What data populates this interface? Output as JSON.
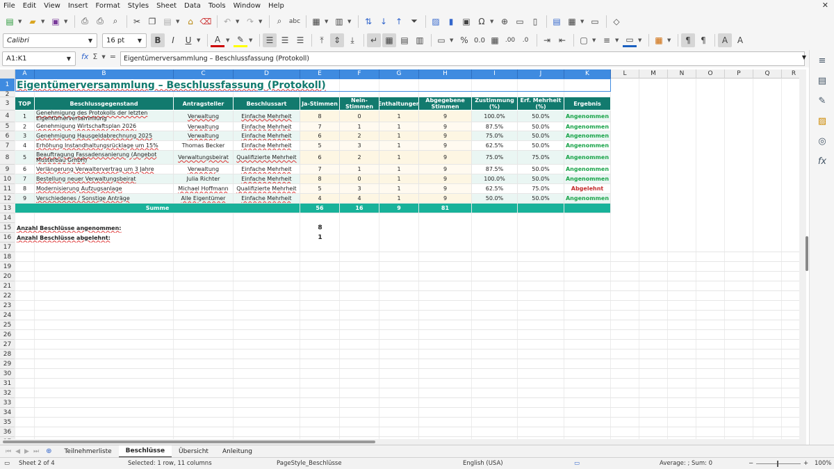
{
  "menu": [
    "File",
    "Edit",
    "View",
    "Insert",
    "Format",
    "Styles",
    "Sheet",
    "Data",
    "Tools",
    "Window",
    "Help"
  ],
  "toolbar": {
    "font_name": "Calibri",
    "font_size": "16 pt"
  },
  "formula_bar": {
    "name_box": "A1:K1",
    "sum_symbol": "Σ",
    "equals_symbol": "=",
    "content": "Eigentümerversammlung – Beschlussfassung (Protokoll)"
  },
  "columns": [
    "A",
    "B",
    "C",
    "D",
    "E",
    "F",
    "G",
    "H",
    "I",
    "J",
    "K",
    "L",
    "M",
    "N",
    "O",
    "P",
    "Q",
    "R"
  ],
  "rows": [
    "1",
    "2",
    "3",
    "4",
    "5",
    "6",
    "7",
    "8",
    "9",
    "10",
    "11",
    "12",
    "13",
    "14",
    "15",
    "16",
    "17",
    "18",
    "19",
    "20",
    "21",
    "22",
    "23",
    "24",
    "25",
    "26",
    "27",
    "28",
    "29",
    "30",
    "31",
    "32",
    "33",
    "34",
    "35",
    "36",
    "37"
  ],
  "sheet": {
    "title": "Eigentümerversammlung – Beschlussfassung (Protokoll)",
    "headers": [
      "TOP",
      "Beschlussgegenstand",
      "Antragsteller",
      "Beschlussart",
      "Ja-Stimmen",
      "Nein-Stimmen",
      "Enthaltungen",
      "Abgegebene Stimmen",
      "Zustimmung (%)",
      "Erf. Mehrheit (%)",
      "Ergebnis"
    ],
    "data_rows": [
      [
        "1",
        "Genehmigung des Protokolls der letzten Eigentümerversammlung",
        "Verwaltung",
        "Einfache Mehrheit",
        "8",
        "0",
        "1",
        "9",
        "100.0%",
        "50.0%",
        "Angenommen"
      ],
      [
        "2",
        "Genehmigung Wirtschaftsplan 2026",
        "Verwaltung",
        "Einfache Mehrheit",
        "7",
        "1",
        "1",
        "9",
        "87.5%",
        "50.0%",
        "Angenommen"
      ],
      [
        "3",
        "Genehmigung Hausgeldabrechnung 2025",
        "Verwaltung",
        "Einfache Mehrheit",
        "6",
        "2",
        "1",
        "9",
        "75.0%",
        "50.0%",
        "Angenommen"
      ],
      [
        "4",
        "Erhöhung Instandhaltungsrücklage um 15%",
        "Thomas Becker",
        "Einfache Mehrheit",
        "5",
        "3",
        "1",
        "9",
        "62.5%",
        "50.0%",
        "Angenommen"
      ],
      [
        "5",
        "Beauftragung Fassadensanierung (Angebot Musterbau GmbH)",
        "Verwaltungsbeirat",
        "Qualifizierte Mehrheit",
        "6",
        "2",
        "1",
        "9",
        "75.0%",
        "75.0%",
        "Angenommen"
      ],
      [
        "6",
        "Verlängerung Verwaltervertrag um 3 Jahre",
        "Verwaltung",
        "Einfache Mehrheit",
        "7",
        "1",
        "1",
        "9",
        "87.5%",
        "50.0%",
        "Angenommen"
      ],
      [
        "7",
        "Bestellung neuer Verwaltungsbeirat",
        "Julia Richter",
        "Einfache Mehrheit",
        "8",
        "0",
        "1",
        "9",
        "100.0%",
        "50.0%",
        "Angenommen"
      ],
      [
        "8",
        "Modernisierung Aufzugsanlage",
        "Michael Hoffmann",
        "Qualifizierte Mehrheit",
        "5",
        "3",
        "1",
        "9",
        "62.5%",
        "75.0%",
        "Abgelehnt"
      ],
      [
        "9",
        "Verschiedenes / Sonstige Anträge",
        "Alle Eigentümer",
        "Einfache Mehrheit",
        "4",
        "4",
        "1",
        "9",
        "50.0%",
        "50.0%",
        "Angenommen"
      ]
    ],
    "sum_row": {
      "label": "Summe",
      "ja": "56",
      "nein": "16",
      "enth": "9",
      "abg": "81"
    },
    "summary": [
      {
        "label": "Anzahl Beschlüsse angenommen:",
        "value": "8"
      },
      {
        "label": "Anzahl Beschlüsse abgelehnt:",
        "value": "1"
      }
    ]
  },
  "tabs": [
    "Teilnehmerliste",
    "Beschlüsse",
    "Übersicht",
    "Anleitung"
  ],
  "active_tab": "Beschlüsse",
  "status": {
    "sheet": "Sheet 2 of 4",
    "selection": "Selected: 1 row, 11 columns",
    "page_style": "PageStyle_Beschlüsse",
    "language": "English (USA)",
    "aggregate": "Average: ; Sum: 0",
    "zoom": "100%"
  },
  "colors": {
    "header": "#127a6e",
    "sum": "#18b29a",
    "ok": "#1aa44a",
    "bad": "#c42b2b",
    "selection": "#3f8be0"
  }
}
